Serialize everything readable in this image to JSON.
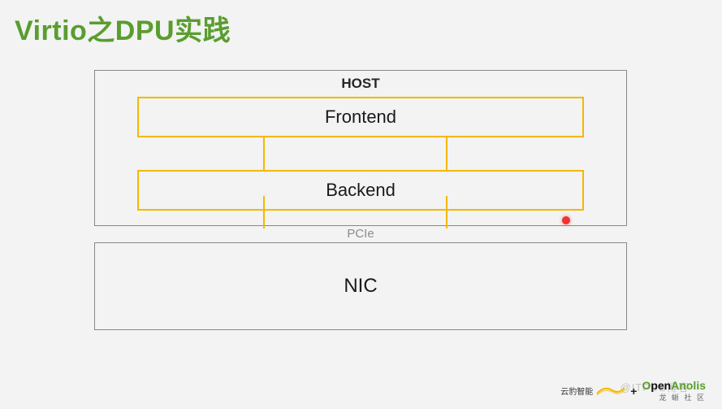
{
  "title": "Virtio之DPU实践",
  "diagram": {
    "host_label": "HOST",
    "frontend": "Frontend",
    "backend": "Backend",
    "bus_label": "PCIe",
    "nic": "NIC"
  },
  "footer": {
    "logo1_text": "云豹智能",
    "plus": "+",
    "logo2_prefix": "O",
    "logo2_mid": "pen",
    "logo2_suffix": "Anolis",
    "sub": "龙 蜥 社 区"
  },
  "watermark": "@ITPUB博客"
}
